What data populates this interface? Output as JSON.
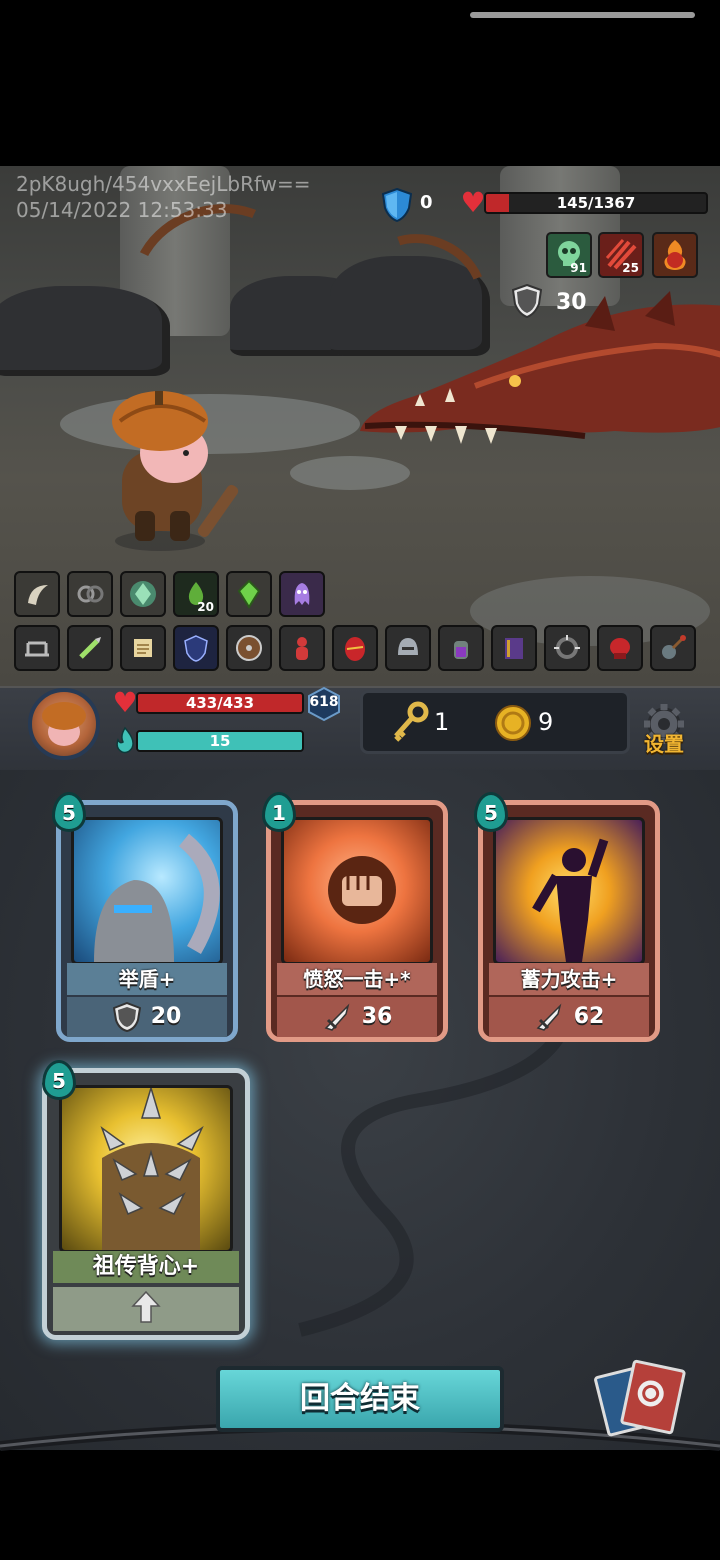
{
  "signature": {
    "line1": "2pK8ugh/454vxxEejLbRfw==",
    "line2": "05/14/2022 12:53:33"
  },
  "enemy": {
    "block": "0",
    "hp_text": "145/1367",
    "hp_fraction": 0.106,
    "intents": [
      {
        "icon": "skull-poison-icon",
        "value": "91"
      },
      {
        "icon": "claw-slash-icon",
        "value": "25"
      },
      {
        "icon": "fire-apple-icon",
        "value": ""
      }
    ],
    "armor_value": "30"
  },
  "relics_row1": [
    {
      "icon": "claw-icon"
    },
    {
      "icon": "chain-ring-icon"
    },
    {
      "icon": "green-crystal-icon"
    },
    {
      "icon": "poison-drop-icon",
      "value": "20"
    },
    {
      "icon": "green-gem-icon"
    },
    {
      "icon": "purple-ghost-icon"
    }
  ],
  "relics_row2": [
    {
      "icon": "bear-trap-icon"
    },
    {
      "icon": "poison-dagger-icon"
    },
    {
      "icon": "scroll-icon"
    },
    {
      "icon": "blue-crest-icon"
    },
    {
      "icon": "round-shield-icon"
    },
    {
      "icon": "red-figure-icon"
    },
    {
      "icon": "red-egg-icon"
    },
    {
      "icon": "helmet-icon"
    },
    {
      "icon": "potion-jar-icon"
    },
    {
      "icon": "spellbook-icon"
    },
    {
      "icon": "spiked-collar-icon"
    },
    {
      "icon": "boxing-glove-icon"
    },
    {
      "icon": "mace-icon"
    }
  ],
  "player": {
    "hp_text": "433/433",
    "hp_fraction": 1.0,
    "block": "618",
    "energy_text": "15",
    "energy_fraction": 1.0,
    "keys": "1",
    "gold": "9",
    "settings_label": "设置"
  },
  "hand": [
    {
      "cost": "5",
      "name": "举盾+",
      "value": "20",
      "value_icon": "shield-icon",
      "type": "skill"
    },
    {
      "cost": "1",
      "name": "愤怒一击+*",
      "value": "36",
      "value_icon": "sword-icon",
      "type": "attack"
    },
    {
      "cost": "5",
      "name": "蓄力攻击+",
      "value": "62",
      "value_icon": "sword-icon",
      "type": "attack"
    },
    {
      "cost": "5",
      "name": "祖传背心+",
      "value": "",
      "value_icon": "upgrade-arrow-icon",
      "type": "power"
    }
  ],
  "end_turn_label": "回合结束",
  "colors": {
    "enemy_hp": "#c0282a",
    "player_hp": "#c0282a",
    "energy": "#3fc1b7",
    "skill_frame": "#7fa7cc",
    "attack_frame": "#e29a86",
    "power_frame": "#c3d0d6"
  }
}
